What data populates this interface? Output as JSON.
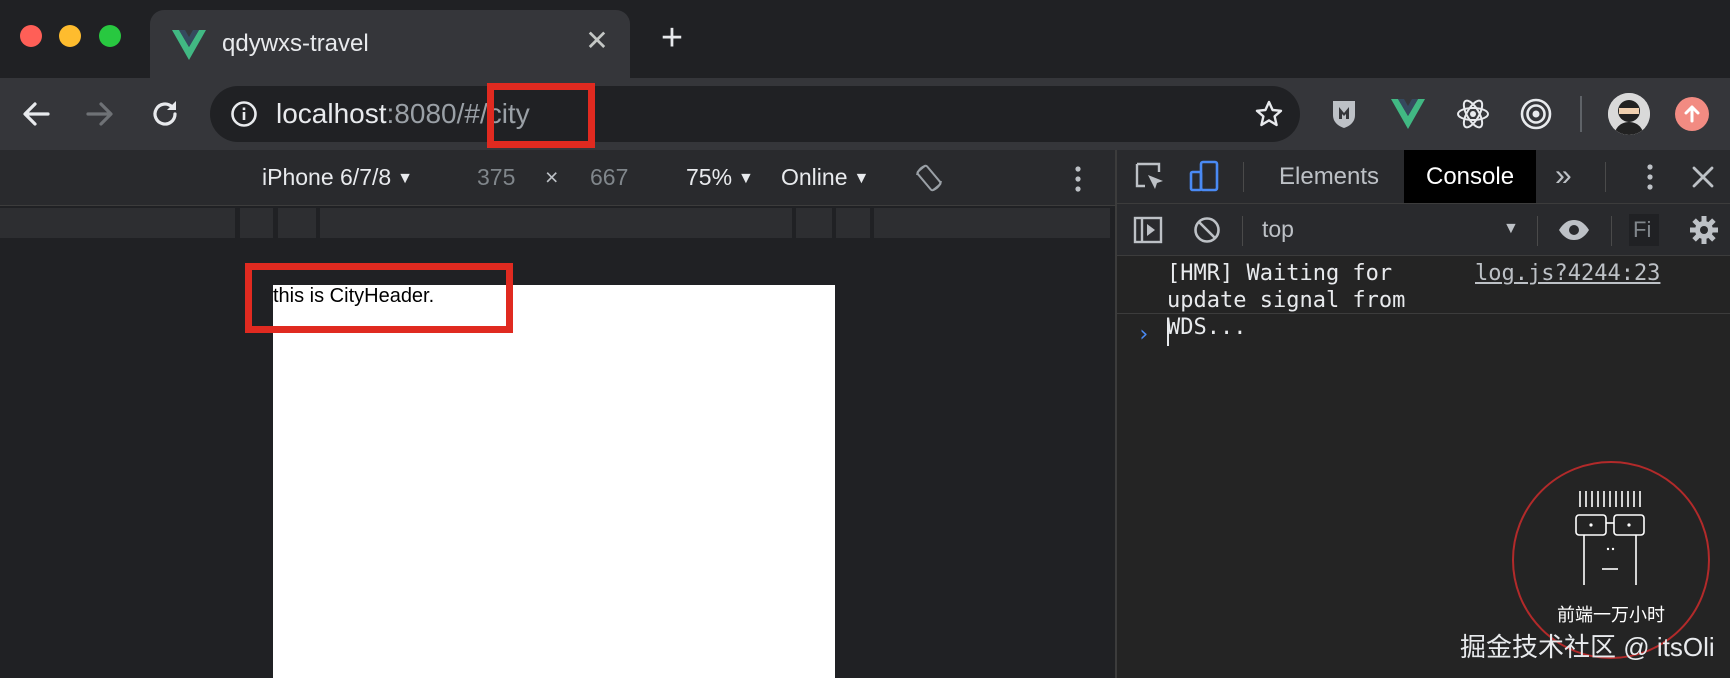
{
  "window": {
    "tab_title": "qdywxs-travel",
    "tab_favicon": "vue-logo-icon",
    "new_tab_label": "+"
  },
  "toolbar": {
    "url_host": "localhost",
    "url_rest": ":8080/#/city",
    "extensions": [
      "shield-extension-icon",
      "vue-devtools-icon",
      "react-devtools-icon",
      "target-extension-icon"
    ]
  },
  "device_toolbar": {
    "device": "iPhone 6/7/8",
    "width": "375",
    "times": "×",
    "height": "667",
    "zoom": "75%",
    "network": "Online"
  },
  "page": {
    "text": "this is CityHeader."
  },
  "devtools": {
    "tabs": [
      "Elements",
      "Console"
    ],
    "active_tab": "Console",
    "context": "top",
    "filter_placeholder": "Fi",
    "message_text": "[HMR] Waiting for update signal from WDS...",
    "message_source": "log.js?4244:23",
    "prompt": "›"
  },
  "watermark": {
    "stamp_text": "前端一万小时",
    "credit": "掘金技术社区 @ itsOli"
  },
  "colors": {
    "highlight": "#e02a20",
    "vue_green": "#41b883",
    "accent_blue": "#4a8af4"
  }
}
